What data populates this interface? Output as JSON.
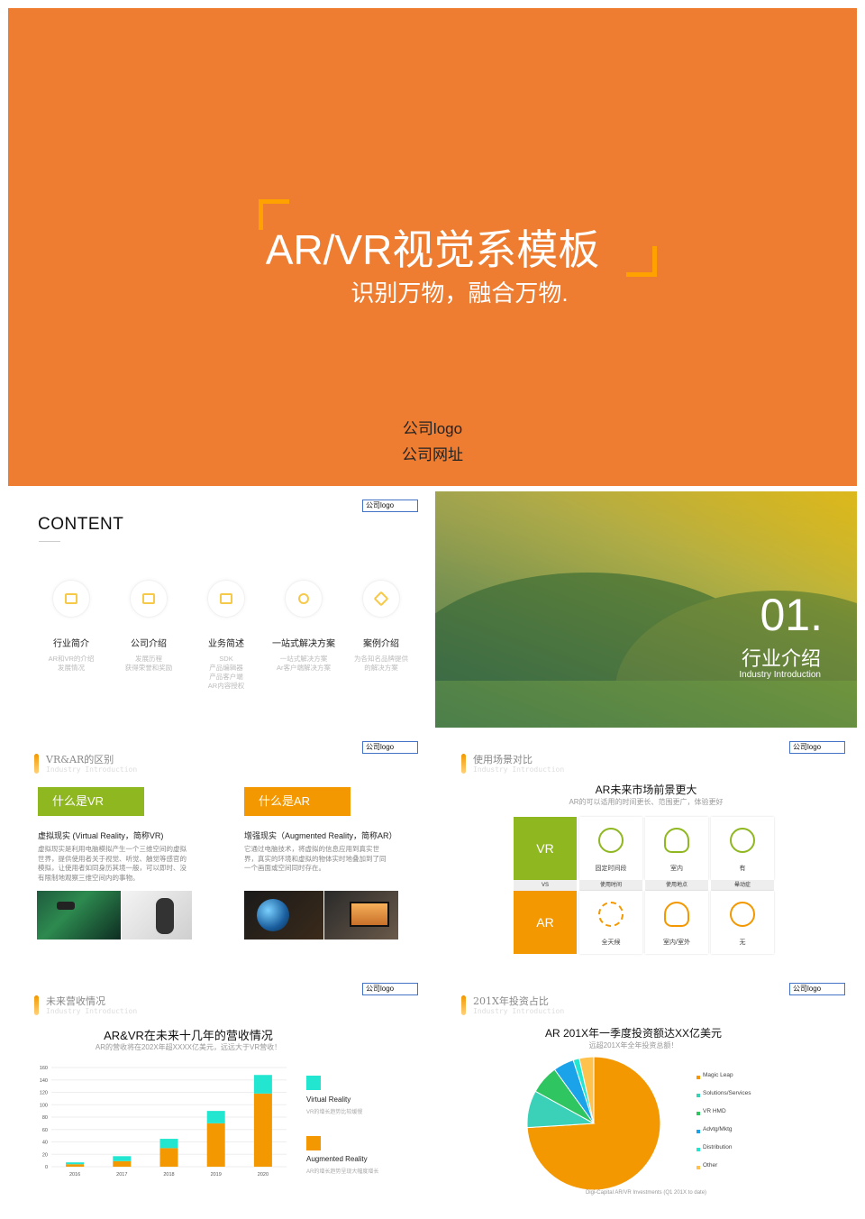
{
  "cover": {
    "title": "AR/VR视觉系模板",
    "subtitle": "识别万物，融合万物.",
    "logo": "公司logo",
    "url": "公司网址",
    "bg_color": "#ee7d31",
    "accent_color": "#ffa200"
  },
  "logo_label": "公司logo",
  "content": {
    "title": "CONTENT",
    "items": [
      {
        "label": "行业简介",
        "desc": [
          "AR和VR的介绍",
          "发展情况"
        ],
        "icon": "document-icon"
      },
      {
        "label": "公司介绍",
        "desc": [
          "发展历程",
          "获得荣誉和奖励"
        ],
        "icon": "wallet-icon"
      },
      {
        "label": "业务简述",
        "desc": [
          "SDK",
          "产品编辑器",
          "产品客户端",
          "AR内容授权"
        ],
        "icon": "image-icon"
      },
      {
        "label": "一站式解决方案",
        "desc": [
          "一站式解决方案",
          "Ar客户端解决方案"
        ],
        "icon": "search-icon"
      },
      {
        "label": "案例介绍",
        "desc": [
          "为各知名品牌提供",
          "的解决方案"
        ],
        "icon": "diamond-icon"
      }
    ]
  },
  "section": {
    "number": "01.",
    "title": "行业介绍",
    "subtitle": "Industry Introduction"
  },
  "vrar": {
    "title": "VR&AR的区别",
    "subtitle": "Industry Introduction",
    "vr_tag": "什么是VR",
    "vr_title": "虚拟现实 (Virtual Reality，简称VR)",
    "vr_body": [
      "虚拟现实是利用电脑模拟产生一个三维空间的虚拟",
      "世界，提供使用者关于视觉、听觉、触觉等感官的",
      "模拟，让使用者如同身历其境一般，可以即时、没",
      "有限制地观察三维空间内的事物。"
    ],
    "ar_tag": "什么是AR",
    "ar_title": "增强现实（Augmented Reality，简称AR）",
    "ar_body": [
      "它通过电脑技术，将虚拟的信息应用到真实世",
      "界，真实的环境和虚拟的物体实时地叠加到了同",
      "一个画面或空间同时存在。"
    ],
    "vr_color": "#8fb720",
    "ar_color": "#f39800"
  },
  "scene": {
    "title": "使用场景对比",
    "subtitle": "Industry Introduction",
    "heading": "AR未来市场前景更大",
    "heading_sub": "AR的可以适用的时间更长、范围更广，体验更好",
    "vr_label": "VR",
    "ar_label": "AR",
    "vs_label": "VS",
    "vr_cells": [
      {
        "label": "固定时间段",
        "icon": "clock-icon"
      },
      {
        "label": "室内",
        "icon": "lightbulb-icon"
      },
      {
        "label": "有",
        "icon": "dizzy-face-icon"
      }
    ],
    "strip_labels": [
      "使用时间",
      "使用地点",
      "晕动症"
    ],
    "ar_cells": [
      {
        "label": "全天候",
        "icon": "cycle-icon"
      },
      {
        "label": "室内/室外",
        "icon": "bulb-sun-icon"
      },
      {
        "label": "无",
        "icon": "smile-face-icon"
      }
    ]
  },
  "revenue": {
    "title": "未来营收情况",
    "subtitle": "Industry Introduction",
    "heading": "AR&VR在未来十几年的营收情况",
    "heading_sub": "AR的营收将在202X年超XXXX亿美元，远远大于VR营收！",
    "legend": [
      {
        "name": "Virtual Reality",
        "desc": "VR的增长趋势比较缓慢",
        "color": "#22e6cf"
      },
      {
        "name": "Augmented Reality",
        "desc": "AR的增长趋势呈现大幅度增长",
        "color": "#f39800"
      }
    ]
  },
  "invest": {
    "title": "201X年投资占比",
    "subtitle": "Industry Introduction",
    "heading": "AR 201X年一季度投资额达XX亿美元",
    "heading_sub": "远超201X年全年投资总额！",
    "source": "Digi-Capital AR/VR Investments (Q1 201X to date)"
  },
  "chart_data": [
    {
      "type": "bar",
      "stacked": true,
      "categories": [
        "2016",
        "2017",
        "2018",
        "2019",
        "2020"
      ],
      "series": [
        {
          "name": "Augmented Reality",
          "values": [
            4,
            9,
            30,
            70,
            118
          ],
          "color": "#f39800"
        },
        {
          "name": "Virtual Reality",
          "values": [
            3,
            8,
            15,
            20,
            30
          ],
          "color": "#22e6cf"
        }
      ],
      "yticks": [
        0,
        20,
        40,
        60,
        80,
        100,
        120,
        140,
        160
      ],
      "ylim": [
        0,
        160
      ],
      "grid": true
    },
    {
      "type": "pie",
      "labels": [
        "Magic Leap",
        "Solutions/Services",
        "VR HMD",
        "Advtg/Mktg",
        "Distribution",
        "Other"
      ],
      "values": [
        74,
        9,
        7,
        5,
        1.5,
        3.5
      ],
      "colors": [
        "#f39800",
        "#3ad1b8",
        "#2fc661",
        "#1aa3e8",
        "#22e6cf",
        "#ffc24d"
      ],
      "legend": "right"
    }
  ]
}
